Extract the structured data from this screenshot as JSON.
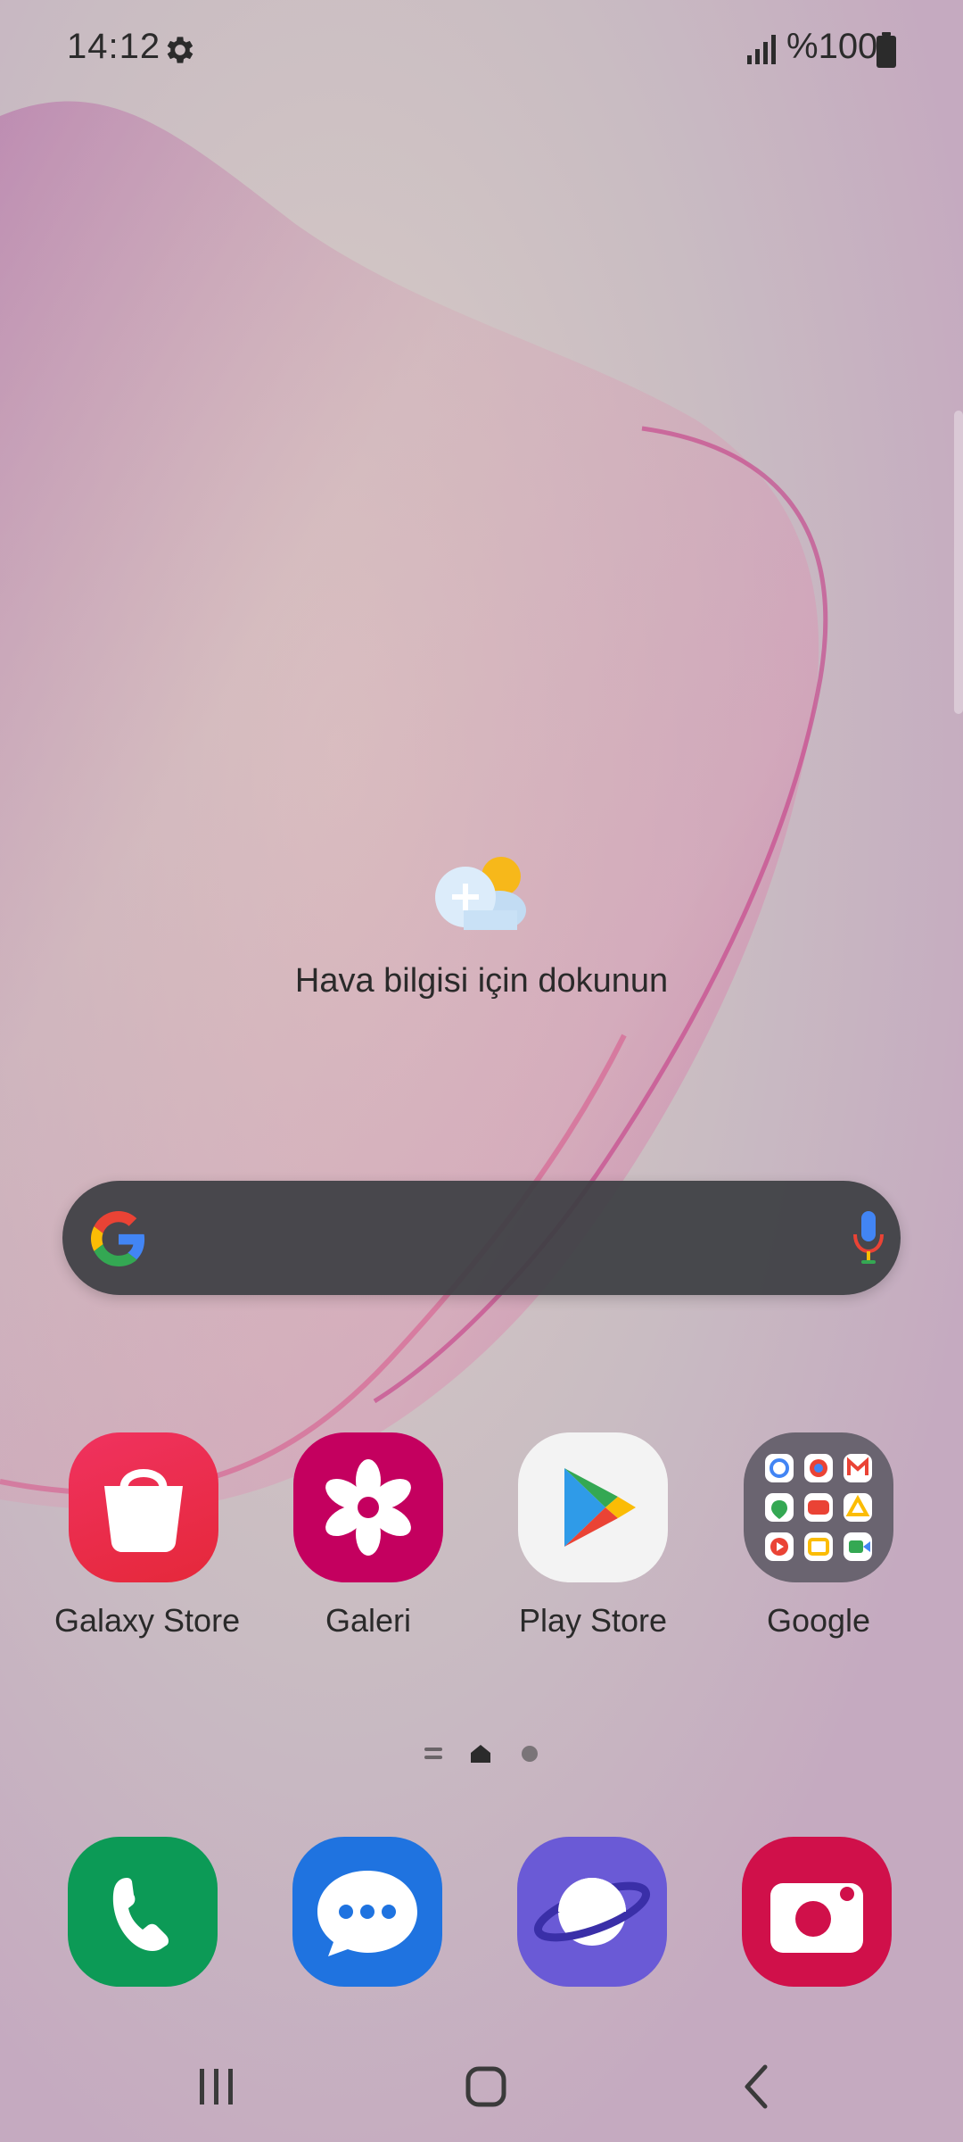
{
  "status_bar": {
    "time": "14:12",
    "battery_percent": "%100"
  },
  "weather_widget": {
    "prompt": "Hava bilgisi için dokunun"
  },
  "search_bar": {
    "logo_icon": "google-g-icon",
    "mic_icon": "microphone-icon"
  },
  "home_apps": [
    {
      "label": "Galaxy Store",
      "icon": "shopping-bag-icon",
      "color": "#e8234c"
    },
    {
      "label": "Galeri",
      "icon": "flower-icon",
      "color": "#c4005f"
    },
    {
      "label": "Play Store",
      "icon": "play-triangle-icon",
      "color": "#f3f3f3"
    },
    {
      "label": "Google",
      "icon": "google-folder-icon",
      "color": "#6a6470"
    }
  ],
  "dock_apps": [
    {
      "icon": "phone-icon",
      "color": "#0c9a56"
    },
    {
      "icon": "messages-icon",
      "color": "#1f73e0"
    },
    {
      "icon": "internet-planet-icon",
      "color": "#6a5ad6"
    },
    {
      "icon": "camera-icon",
      "color": "#d0104a"
    }
  ],
  "page_indicator": {
    "current_page": "home"
  }
}
